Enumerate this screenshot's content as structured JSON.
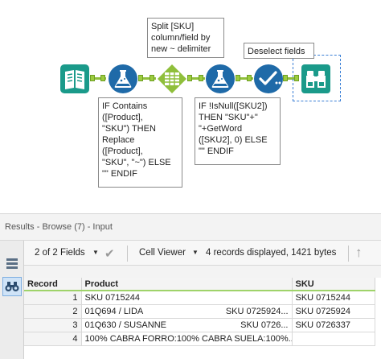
{
  "workflow": {
    "tools": [
      {
        "name": "input-data-tool",
        "icon": "book-icon"
      },
      {
        "name": "formula-tool-1",
        "icon": "flask-icon"
      },
      {
        "name": "text-to-columns-tool",
        "icon": "table-split-icon"
      },
      {
        "name": "formula-tool-2",
        "icon": "flask-icon"
      },
      {
        "name": "select-tool",
        "icon": "check-icon"
      },
      {
        "name": "browse-tool",
        "icon": "binoculars-icon"
      }
    ],
    "annotations": {
      "split": "Split [SKU]\ncolumn/field by\nnew ~ delimiter",
      "deselect": "Deselect fields",
      "formula1": "IF Contains\n([Product],\n\"SKU\") THEN\nReplace\n([Product],\n\"SKU\", \"~\") ELSE\n\"\" ENDIF",
      "formula2": "IF !IsNull([SKU2])\nTHEN \"SKU\"+\"\n\"+GetWord\n([SKU2], 0) ELSE\n\"\" ENDIF"
    },
    "colors": {
      "teal": "#1a9a8a",
      "blue": "#1f6aa8",
      "green": "#8fbf3b"
    }
  },
  "results": {
    "title": "Results - Browse (7) - Input",
    "fields_label": "2 of 2 Fields",
    "viewer_label": "Cell Viewer",
    "records_info": "4 records displayed, 1421 bytes",
    "columns": [
      "Record",
      "Product",
      "SKU"
    ],
    "rows": [
      {
        "record": "1",
        "product": "SKU 0715244",
        "product_sku": "",
        "sku": "SKU 0715244"
      },
      {
        "record": "2",
        "product": "01Q694 / LIDA",
        "product_sku": "SKU 0725924...",
        "sku": "SKU 0725924"
      },
      {
        "record": "3",
        "product": "01Q630 / SUSANNE",
        "product_sku": "SKU 0726...",
        "sku": "SKU 0726337"
      },
      {
        "record": "4",
        "product": "100% CABRA FORRO:100% CABRA SUELA:100%...",
        "product_sku": "",
        "sku": ""
      }
    ]
  }
}
